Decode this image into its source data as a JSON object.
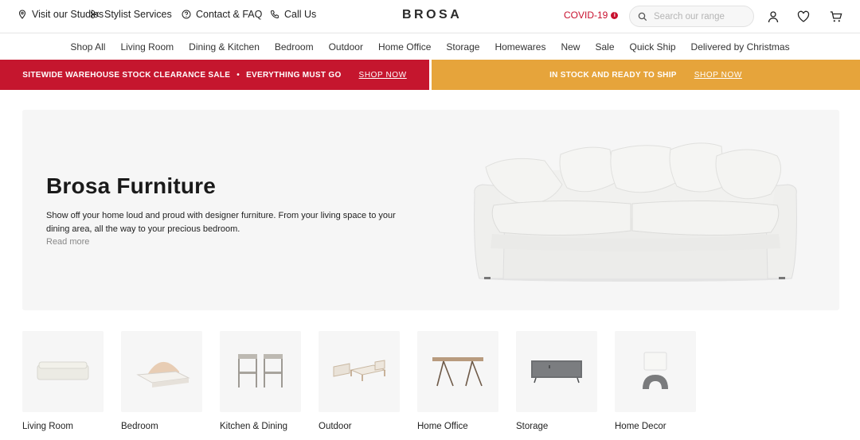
{
  "header": {
    "utility_links": [
      "Visit our Studios",
      "Stylist Services",
      "Contact & FAQ",
      "Call Us"
    ],
    "logo": "BROSA",
    "covid_label": "COVID-19",
    "covid_badge": "i",
    "search_placeholder": "Search our range"
  },
  "nav": [
    "Shop All",
    "Living Room",
    "Dining & Kitchen",
    "Bedroom",
    "Outdoor",
    "Home Office",
    "Storage",
    "Homewares",
    "New",
    "Sale",
    "Quick Ship",
    "Delivered by Christmas"
  ],
  "banners": {
    "left": {
      "text_a": "SITEWIDE WAREHOUSE STOCK CLEARANCE SALE",
      "bullet": "•",
      "text_b": "EVERYTHING MUST GO",
      "cta": "SHOP NOW",
      "color": "#c5162e"
    },
    "right": {
      "text": "IN STOCK AND READY TO SHIP",
      "cta": "SHOP NOW",
      "color": "#e6a43b"
    }
  },
  "hero": {
    "title": "Brosa Furniture",
    "description": "Show off your home loud and proud with designer furniture. From your living space to your dining area, all the way to your precious bedroom.",
    "read_more": "Read more"
  },
  "categories": [
    "Living Room",
    "Bedroom",
    "Kitchen & Dining",
    "Outdoor",
    "Home Office",
    "Storage",
    "Home Decor"
  ],
  "icons": [
    "location-pin-icon",
    "stylist-icon",
    "question-icon",
    "phone-icon",
    "search-icon",
    "user-icon",
    "heart-icon",
    "cart-icon"
  ]
}
